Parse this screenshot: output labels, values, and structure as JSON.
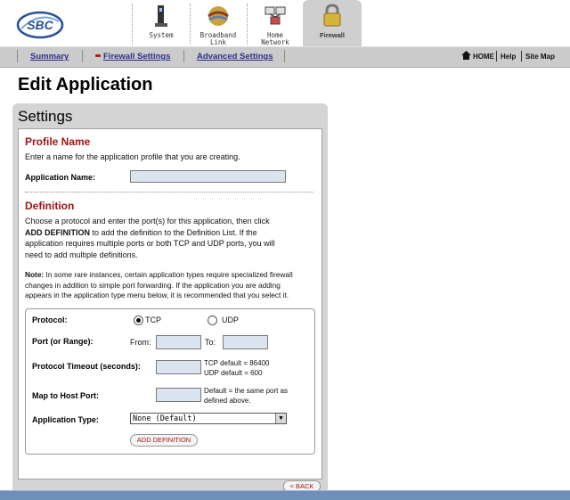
{
  "header": {
    "logo_text": "SBC",
    "tabs": [
      {
        "label_1": "System",
        "label_2": ""
      },
      {
        "label_1": "Broadband",
        "label_2": "Link"
      },
      {
        "label_1": "Home",
        "label_2": "Network"
      },
      {
        "label_1": "Firewall",
        "label_2": ""
      }
    ]
  },
  "nav": {
    "summary": "Summary",
    "firewall_settings": "Firewall Settings",
    "advanced_settings": "Advanced Settings",
    "home": "HOME",
    "help": "Help",
    "site_map": "Site Map"
  },
  "page": {
    "title": "Edit Application",
    "settings_title": "Settings"
  },
  "profile": {
    "heading": "Profile Name",
    "desc": "Enter a name for the application profile that you are creating.",
    "app_name_label": "Application Name:",
    "app_name_value": ""
  },
  "definition": {
    "heading": "Definition",
    "desc_line1": "Choose a protocol and enter the port(s) for this application, then click",
    "desc_line2_bold": "ADD DEFINITION",
    "desc_line2_rest": " to add the definition to the Definition List. If the",
    "desc_line3": "application requires multiple ports or both TCP and UDP ports, you will",
    "desc_line4": "need to add multiple definitions.",
    "note_bold": "Note:",
    "note_line1": " In some rare instances, certain application types require specialized firewall",
    "note_line2": "changes in addition to simple port forwarding. If the application you are adding",
    "note_line3": "appears in the application type menu below, it is recommended that you select it."
  },
  "form": {
    "protocol_label": "Protocol:",
    "tcp_label": "TCP",
    "udp_label": "UDP",
    "port_label": "Port (or Range):",
    "from_label": "From:",
    "to_label": "To:",
    "timeout_label": "Protocol Timeout (seconds):",
    "tcp_default": "TCP default = 86400",
    "udp_default": "UDP default = 600",
    "map_label": "Map to Host Port:",
    "map_hint_1": "Default = the same port as",
    "map_hint_2": "defined above.",
    "app_type_label": "Application Type:",
    "app_type_value": "None (Default)",
    "add_button": "ADD DEFINITION"
  },
  "footer": {
    "back_button": "< BACK"
  },
  "colors": {
    "accent_red": "#a01414",
    "nav_blue": "#2b2f8a",
    "nav_bg": "#cbcbcb",
    "field_bg": "#d9e4ee"
  }
}
